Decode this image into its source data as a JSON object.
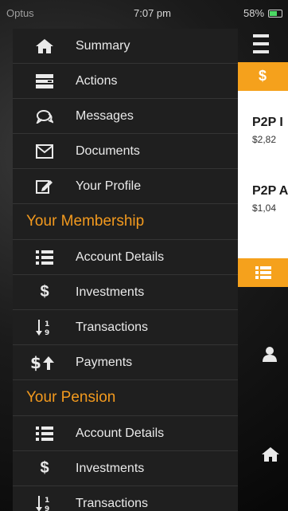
{
  "status_bar": {
    "carrier": "Optus",
    "time": "7:07 pm",
    "battery": "58%"
  },
  "menu": {
    "main_items": [
      {
        "label": "Summary",
        "icon": "home-icon"
      },
      {
        "label": "Actions",
        "icon": "list-icon"
      },
      {
        "label": "Messages",
        "icon": "chat-icon"
      },
      {
        "label": "Documents",
        "icon": "envelope-icon"
      },
      {
        "label": "Your Profile",
        "icon": "edit-icon"
      }
    ],
    "membership": {
      "heading": "Your Membership",
      "items": [
        {
          "label": "Account Details",
          "icon": "list-icon"
        },
        {
          "label": "Investments",
          "icon": "dollar-icon"
        },
        {
          "label": "Transactions",
          "icon": "sort-numeric-icon"
        },
        {
          "label": "Payments",
          "icon": "dollar-up-icon"
        }
      ]
    },
    "pension": {
      "heading": "Your Pension",
      "items": [
        {
          "label": "Account Details",
          "icon": "list-icon"
        },
        {
          "label": "Investments",
          "icon": "dollar-icon"
        },
        {
          "label": "Transactions",
          "icon": "sort-numeric-icon"
        }
      ]
    }
  },
  "background_panel": {
    "section_icon": "$",
    "cards": [
      {
        "title": "P2P I",
        "value": "$2,82"
      },
      {
        "title": "P2P A",
        "value": "$1,04"
      }
    ]
  },
  "colors": {
    "accent": "#f5a11c",
    "drawer_bg": "#1f1f1f",
    "text": "#eaeaea"
  }
}
